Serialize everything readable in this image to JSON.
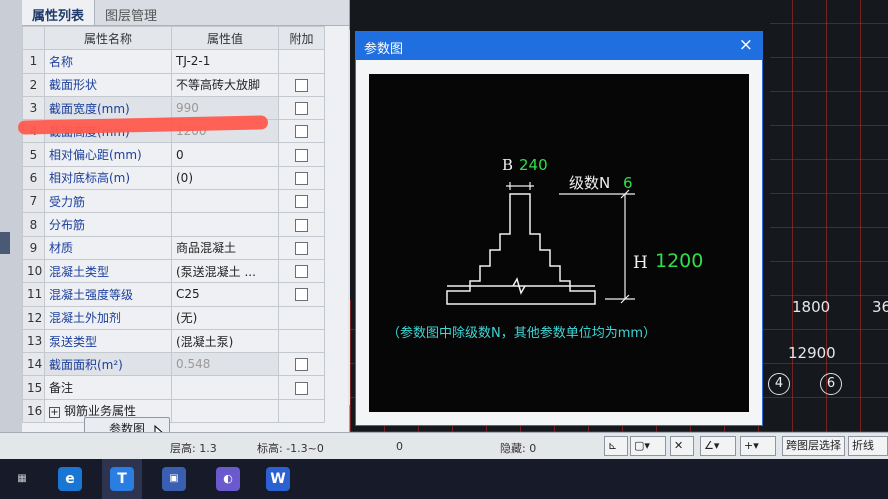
{
  "tabs": [
    {
      "label": "属性列表"
    },
    {
      "label": "图层管理"
    }
  ],
  "table": {
    "headers": {
      "name": "属性名称",
      "value": "属性值",
      "extra": "附加"
    },
    "rows": [
      {
        "idx": "1",
        "name": "名称",
        "value": "TJ-2-1"
      },
      {
        "idx": "2",
        "name": "截面形状",
        "value": "不等高砖大放脚"
      },
      {
        "idx": "3",
        "name": "截面宽度(mm)",
        "value": "990"
      },
      {
        "idx": "4",
        "name": "截面高度(mm)",
        "value": "1200"
      },
      {
        "idx": "5",
        "name": "相对偏心距(mm)",
        "value": "0"
      },
      {
        "idx": "6",
        "name": "相对底标高(m)",
        "value": "(0)"
      },
      {
        "idx": "7",
        "name": "受力筋",
        "value": ""
      },
      {
        "idx": "8",
        "name": "分布筋",
        "value": ""
      },
      {
        "idx": "9",
        "name": "材质",
        "value": "商品混凝土"
      },
      {
        "idx": "10",
        "name": "混凝土类型",
        "value": "(泵送混凝土 ..."
      },
      {
        "idx": "11",
        "name": "混凝土强度等级",
        "value": "C25"
      },
      {
        "idx": "12",
        "name": "混凝土外加剂",
        "value": "(无)"
      },
      {
        "idx": "13",
        "name": "泵送类型",
        "value": "(混凝土泵)"
      },
      {
        "idx": "14",
        "name": "截面面积(m²)",
        "value": "0.548"
      },
      {
        "idx": "15",
        "name": "备注",
        "value": ""
      },
      {
        "idx": "16",
        "name": "钢筋业务属性",
        "value": ""
      }
    ]
  },
  "param_button": "参数图",
  "dialog": {
    "title": "参数图",
    "close": "×",
    "figure": {
      "b_label": "B",
      "b_value": "240",
      "n_label": "级数N",
      "n_value": "6",
      "h_label": "H",
      "h_value": "1200",
      "note": "（参数图中除级数N，其他参数单位均为mm）"
    }
  },
  "canvas": {
    "labels": [
      "1800",
      "36",
      "12900"
    ],
    "axis_markers": [
      "4",
      "6"
    ]
  },
  "statusbar": {
    "floor": "层高: 1.3",
    "elevation": "标高: -1.3~0",
    "zero": "0",
    "hidden": "隐藏: 0",
    "cross_layer": "跨图层选择",
    "polyline": "折线选"
  },
  "colors": {
    "dialog_title": "#1f6fe0",
    "figure_green": "#2ee04a",
    "figure_cyan": "#3fd6d6",
    "prop_name": "#1c3f9c",
    "grid_red": "#c82828"
  }
}
